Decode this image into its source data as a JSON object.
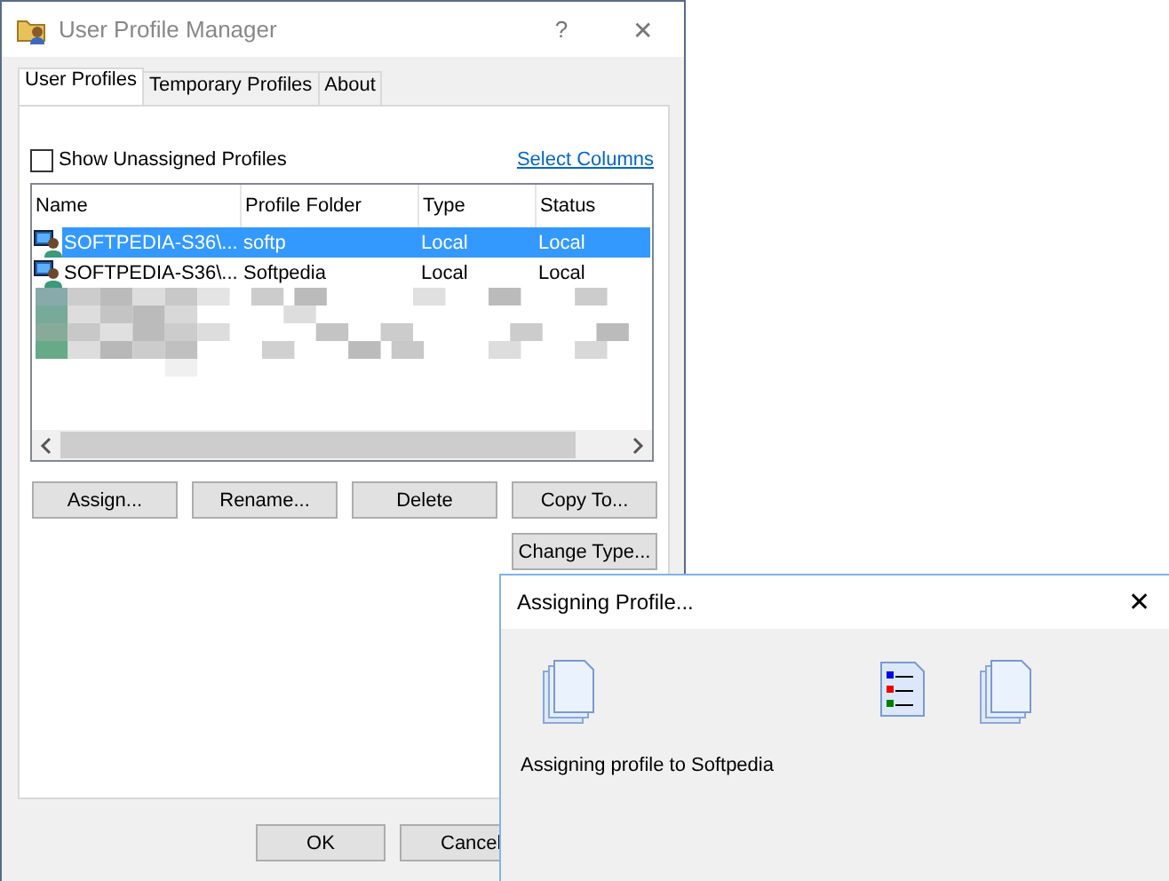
{
  "window": {
    "title": "User Profile Manager",
    "help": "?",
    "close": "✕"
  },
  "tabs": [
    {
      "label": "User Profiles",
      "selected": true
    },
    {
      "label": "Temporary Profiles",
      "selected": false
    },
    {
      "label": "About",
      "selected": false
    }
  ],
  "show_unassigned": {
    "label": "Show Unassigned Profiles",
    "checked": false
  },
  "select_columns_link": "Select Columns",
  "table": {
    "columns": [
      "Name",
      "Profile Folder",
      "Type",
      "Status"
    ],
    "rows": [
      {
        "name": "SOFTPEDIA-S36\\...",
        "folder": "softp",
        "type": "Local",
        "status": "Local",
        "selected": true
      },
      {
        "name": "SOFTPEDIA-S36\\...",
        "folder": "Softpedia",
        "type": "Local",
        "status": "Local",
        "selected": false
      }
    ]
  },
  "buttons": [
    "Assign...",
    "Rename...",
    "Delete",
    "Copy To...",
    "Change Type..."
  ],
  "footer_buttons": [
    "OK",
    "Cancel"
  ],
  "dialog": {
    "title": "Assigning Profile...",
    "close": "✕",
    "message": "Assigning profile to Softpedia"
  }
}
